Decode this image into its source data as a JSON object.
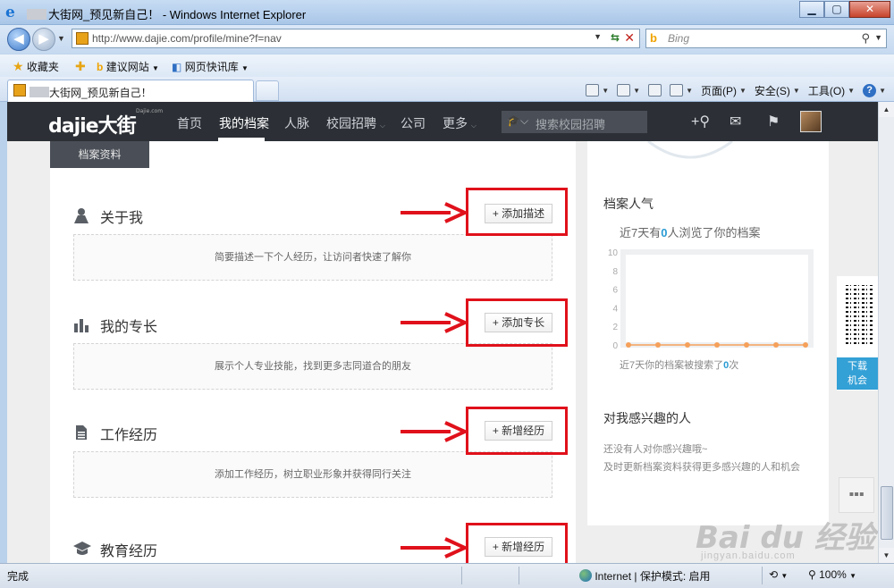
{
  "window": {
    "title": "大街网_预见新自己！ - Windows Internet Explorer",
    "min_label": "▁",
    "max_label": "▢",
    "close_label": "✕"
  },
  "address": {
    "url": "http://www.dajie.com/profile/mine?f=nav",
    "search_placeholder": "Bing"
  },
  "favorites": {
    "favorites_label": "收藏夹",
    "suggested_sites": "建议网站",
    "web_slice": "网页快讯库"
  },
  "tab": {
    "label": "大街网_预见新自己！"
  },
  "commandbar": {
    "page": "页面(P)",
    "safety": "安全(S)",
    "tools": "工具(O)",
    "help_glyph": "?"
  },
  "site": {
    "logo_text": "dajie大街",
    "logo_sub": "Dajie.com",
    "nav": [
      "首页",
      "我的档案",
      "人脉",
      "校园招聘",
      "公司",
      "更多"
    ],
    "search_placeholder": "搜索校园招聘"
  },
  "main": {
    "tab_label": "档案资料",
    "sections": [
      {
        "title": "关于我",
        "button": "+ 添加描述",
        "hint": "简要描述一下个人经历，让访问者快速了解你",
        "icon": "person-icon"
      },
      {
        "title": "我的专长",
        "button": "+ 添加专长",
        "hint": "展示个人专业技能，找到更多志同道合的朋友",
        "icon": "bar-chart-icon"
      },
      {
        "title": "工作经历",
        "button": "+ 新增经历",
        "hint": "添加工作经历，树立职业形象并获得同行关注",
        "icon": "document-icon"
      },
      {
        "title": "教育经历",
        "button": "+ 新增经历",
        "hint": "",
        "icon": "graduation-cap-icon"
      }
    ]
  },
  "sidebar": {
    "popularity_title": "档案人气",
    "views_prefix": "近7天有",
    "views_count": "0",
    "views_suffix": "人浏览了你的档案",
    "searches_prefix": "近7天你的档案被搜索了",
    "searches_count": "0",
    "searches_suffix": "次",
    "interested_title": "对我感兴趣的人",
    "interested_line1": "还没有人对你感兴趣哦~",
    "interested_line2": "及时更新档案资料获得更多感兴趣的人和机会"
  },
  "chart_data": {
    "type": "line",
    "x": [
      1,
      2,
      3,
      4,
      5,
      6,
      7
    ],
    "values": [
      0,
      0,
      0,
      0,
      0,
      0,
      0
    ],
    "yticks": [
      "10",
      "8",
      "6",
      "4",
      "2",
      "0"
    ],
    "ylim": [
      0,
      10
    ],
    "xlabel": "",
    "ylabel": "",
    "series_color": "#f5a05a",
    "grid": false
  },
  "floating": {
    "download_line1": "下载",
    "download_line2": "机会"
  },
  "watermark": {
    "big": "Bai du 经验",
    "small": "jingyan.baidu.com"
  },
  "status": {
    "done": "完成",
    "zone": "Internet | 保护模式: 启用",
    "zoom": "100%"
  },
  "colors": {
    "site_nav_bg": "#2c3036",
    "highlight_red": "#e0111b",
    "accent_blue": "#2a9bd3"
  }
}
